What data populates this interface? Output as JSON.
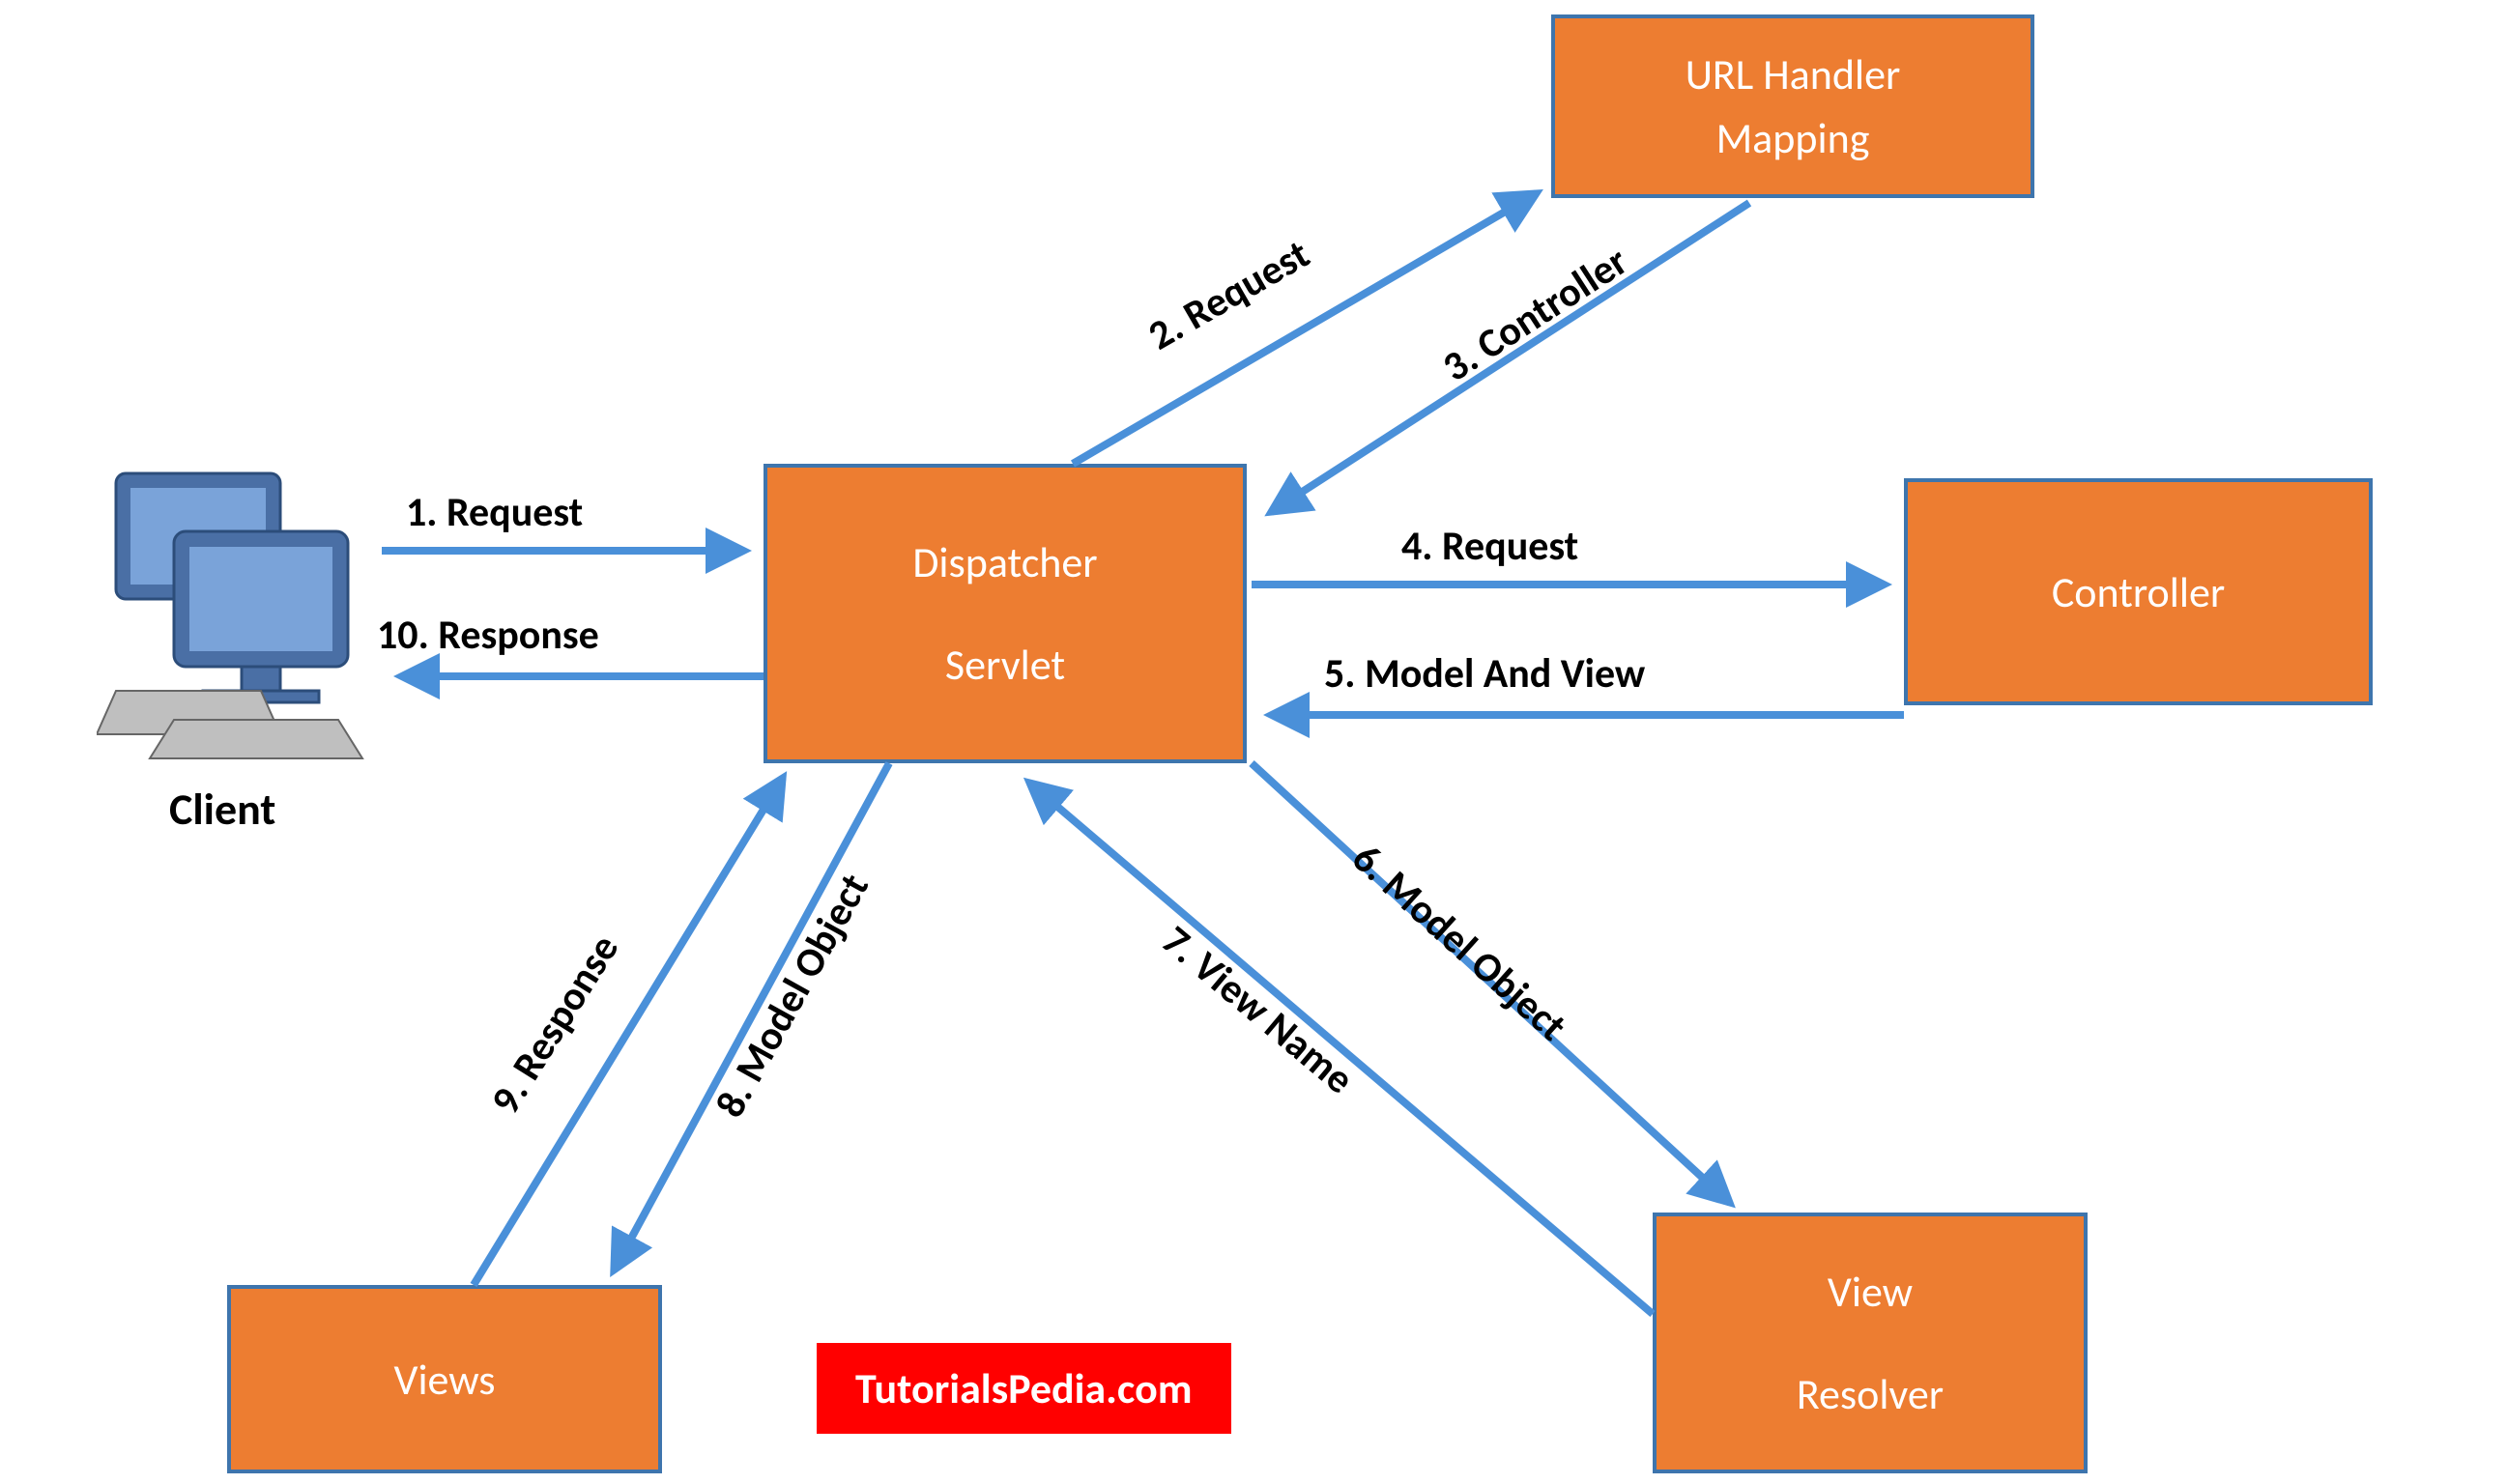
{
  "boxes": {
    "url_handler": {
      "line1": "URL Handler",
      "line2": "Mapping"
    },
    "dispatcher": {
      "line1": "Dispatcher",
      "line2": "Servlet"
    },
    "controller": {
      "line1": "Controller"
    },
    "views": {
      "line1": "Views"
    },
    "view_resolver": {
      "line1": "View",
      "line2": "Resolver"
    }
  },
  "client_label": "Client",
  "labels": {
    "l1": "1. Request",
    "l2": "2. Request",
    "l3": "3. Controller",
    "l4": "4. Request",
    "l5": "5. Model And View",
    "l6": "6. Model Object",
    "l7": "7. View Name",
    "l8": "8. Model Object",
    "l9": "9. Response",
    "l10": "10. Response"
  },
  "watermark": "TutorialsPedia.com",
  "colors": {
    "box_fill": "#ed7d31",
    "box_border": "#3e75ad",
    "arrow": "#4a90d9",
    "watermark_bg": "#ff0000"
  }
}
